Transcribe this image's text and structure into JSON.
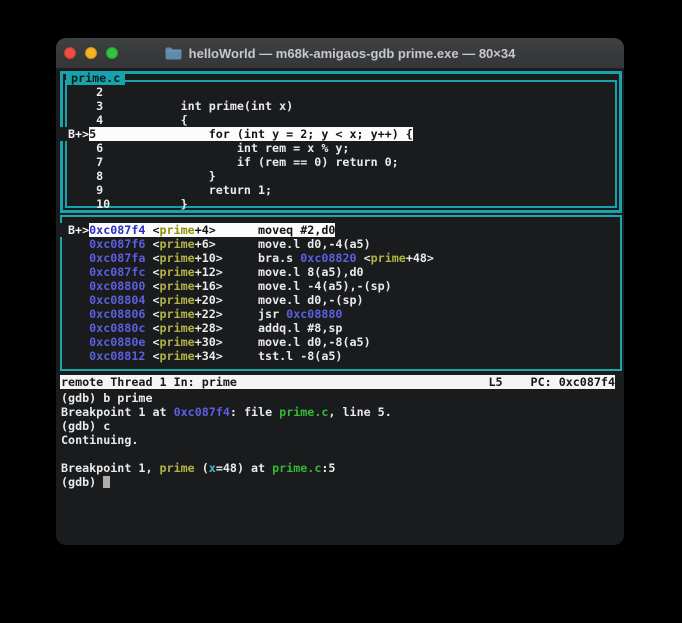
{
  "window": {
    "title": "helloWorld — m68k-amigaos-gdb prime.exe — 80×34"
  },
  "colors": {
    "border_teal": "#17a3ad",
    "address_blue": "#5c5fe0",
    "symbol_olive": "#b2b345",
    "file_green": "#33ba33",
    "variable_cyan": "#41b9d6",
    "highlight_bg": "#fcfcfc",
    "terminal_bg": "#1a1b1d",
    "status_bg": "#f4f4f5",
    "traffic_red": "#ee4d42",
    "traffic_yellow": "#f6b321",
    "traffic_green": "#31c341"
  },
  "source_panel": {
    "title": "prime.c",
    "breakpoint_marker": "B+>",
    "lines": [
      {
        "segments": [
          {
            "c": "t",
            "t": "    2"
          }
        ]
      },
      {
        "segments": [
          {
            "c": "t",
            "t": "    3           int prime(int x)"
          }
        ]
      },
      {
        "segments": [
          {
            "c": "t",
            "t": "    4           {"
          }
        ]
      },
      {
        "segments": [
          {
            "c": "mk",
            "t": "B+>"
          },
          {
            "c": "hl",
            "t": "5                for (int y = 2; y < x; y++) {"
          }
        ]
      },
      {
        "segments": [
          {
            "c": "t",
            "t": "    6                   int rem = x % y;"
          }
        ]
      },
      {
        "segments": [
          {
            "c": "t",
            "t": "    7                   if (rem == 0) return 0;"
          }
        ]
      },
      {
        "segments": [
          {
            "c": "t",
            "t": "    8               }"
          }
        ]
      },
      {
        "segments": [
          {
            "c": "t",
            "t": "    9               return 1;"
          }
        ]
      },
      {
        "segments": [
          {
            "c": "t",
            "t": "    10          }"
          }
        ]
      }
    ]
  },
  "asm_panel": {
    "lines": [
      {
        "segments": [
          {
            "c": "mk",
            "t": "B+>"
          },
          {
            "c": "hla",
            "t": "0xc087f4"
          },
          {
            "c": "hl",
            "t": " <"
          },
          {
            "c": "hls",
            "t": "prime"
          },
          {
            "c": "hl",
            "t": "+4>      moveq #2,d0"
          }
        ]
      },
      {
        "segments": [
          {
            "c": "t",
            "t": "   "
          },
          {
            "c": "a",
            "t": "0xc087f6"
          },
          {
            "c": "t",
            "t": " <"
          },
          {
            "c": "s",
            "t": "prime"
          },
          {
            "c": "t",
            "t": "+6>      move.l d0,-4(a5)"
          }
        ]
      },
      {
        "segments": [
          {
            "c": "t",
            "t": "   "
          },
          {
            "c": "a",
            "t": "0xc087fa"
          },
          {
            "c": "t",
            "t": " <"
          },
          {
            "c": "s",
            "t": "prime"
          },
          {
            "c": "t",
            "t": "+10>     bra.s "
          },
          {
            "c": "a",
            "t": "0xc08820"
          },
          {
            "c": "t",
            "t": " <"
          },
          {
            "c": "s",
            "t": "prime"
          },
          {
            "c": "t",
            "t": "+48>"
          }
        ]
      },
      {
        "segments": [
          {
            "c": "t",
            "t": "   "
          },
          {
            "c": "a",
            "t": "0xc087fc"
          },
          {
            "c": "t",
            "t": " <"
          },
          {
            "c": "s",
            "t": "prime"
          },
          {
            "c": "t",
            "t": "+12>     move.l 8(a5),d0"
          }
        ]
      },
      {
        "segments": [
          {
            "c": "t",
            "t": "   "
          },
          {
            "c": "a",
            "t": "0xc08800"
          },
          {
            "c": "t",
            "t": " <"
          },
          {
            "c": "s",
            "t": "prime"
          },
          {
            "c": "t",
            "t": "+16>     move.l -4(a5),-(sp)"
          }
        ]
      },
      {
        "segments": [
          {
            "c": "t",
            "t": "   "
          },
          {
            "c": "a",
            "t": "0xc08804"
          },
          {
            "c": "t",
            "t": " <"
          },
          {
            "c": "s",
            "t": "prime"
          },
          {
            "c": "t",
            "t": "+20>     move.l d0,-(sp)"
          }
        ]
      },
      {
        "segments": [
          {
            "c": "t",
            "t": "   "
          },
          {
            "c": "a",
            "t": "0xc08806"
          },
          {
            "c": "t",
            "t": " <"
          },
          {
            "c": "s",
            "t": "prime"
          },
          {
            "c": "t",
            "t": "+22>     jsr "
          },
          {
            "c": "a",
            "t": "0xc08880"
          }
        ]
      },
      {
        "segments": [
          {
            "c": "t",
            "t": "   "
          },
          {
            "c": "a",
            "t": "0xc0880c"
          },
          {
            "c": "t",
            "t": " <"
          },
          {
            "c": "s",
            "t": "prime"
          },
          {
            "c": "t",
            "t": "+28>     addq.l #8,sp"
          }
        ]
      },
      {
        "segments": [
          {
            "c": "t",
            "t": "   "
          },
          {
            "c": "a",
            "t": "0xc0880e"
          },
          {
            "c": "t",
            "t": " <"
          },
          {
            "c": "s",
            "t": "prime"
          },
          {
            "c": "t",
            "t": "+30>     move.l d0,-8(a5)"
          }
        ]
      },
      {
        "segments": [
          {
            "c": "t",
            "t": "   "
          },
          {
            "c": "a",
            "t": "0xc08812"
          },
          {
            "c": "t",
            "t": " <"
          },
          {
            "c": "s",
            "t": "prime"
          },
          {
            "c": "t",
            "t": "+34>     tst.l -8(a5)"
          }
        ]
      }
    ]
  },
  "status_bar": {
    "left": "remote Thread 1 In: prime",
    "line_indicator": "L5",
    "pc_indicator": "PC: 0xc087f4"
  },
  "console": {
    "lines": [
      {
        "segments": [
          {
            "c": "t",
            "t": "(gdb) b prime"
          }
        ]
      },
      {
        "segments": [
          {
            "c": "t",
            "t": "Breakpoint 1 at "
          },
          {
            "c": "a",
            "t": "0xc087f4"
          },
          {
            "c": "t",
            "t": ": file "
          },
          {
            "c": "g",
            "t": "prime.c"
          },
          {
            "c": "t",
            "t": ", line 5."
          }
        ]
      },
      {
        "segments": [
          {
            "c": "t",
            "t": "(gdb) c"
          }
        ]
      },
      {
        "segments": [
          {
            "c": "t",
            "t": "Continuing."
          }
        ]
      },
      {
        "segments": [
          {
            "c": "t",
            "t": ""
          }
        ]
      },
      {
        "segments": [
          {
            "c": "t",
            "t": "Breakpoint 1, "
          },
          {
            "c": "s",
            "t": "prime"
          },
          {
            "c": "t",
            "t": " ("
          },
          {
            "c": "cy",
            "t": "x"
          },
          {
            "c": "t",
            "t": "=48) at "
          },
          {
            "c": "g",
            "t": "prime.c"
          },
          {
            "c": "t",
            "t": ":5"
          }
        ]
      },
      {
        "segments": [
          {
            "c": "t",
            "t": "(gdb) "
          }
        ],
        "cursor": true
      }
    ]
  }
}
